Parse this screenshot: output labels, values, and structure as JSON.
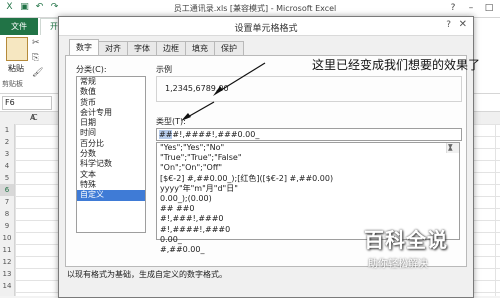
{
  "excel": {
    "window_title": "员工通讯录.xls [兼容模式] - Microsoft Excel",
    "file_tab": "文件",
    "home_tab": "开",
    "paste_label": "粘贴",
    "clipboard_group": "剪贴板",
    "name_box": "F6",
    "column_headers": [
      "A",
      "B",
      "C"
    ],
    "row_headers": [
      "1",
      "2",
      "3",
      "4",
      "5",
      "6",
      "7",
      "8",
      "9",
      "10",
      "11",
      "12",
      "13",
      "14"
    ],
    "selected_row": "6"
  },
  "dialog": {
    "title": "设置单元格格式",
    "help_icon": "?",
    "close_icon": "✕",
    "tabs": [
      "数字",
      "对齐",
      "字体",
      "边框",
      "填充",
      "保护"
    ],
    "category_label": "分类(C):",
    "categories": [
      "常规",
      "数值",
      "货币",
      "会计专用",
      "日期",
      "时间",
      "百分比",
      "分数",
      "科学记数",
      "文本",
      "特殊",
      "自定义"
    ],
    "selected_category": "自定义",
    "sample_label": "示例",
    "sample_value": "1,2345,6789.00",
    "type_label": "类型(T):",
    "type_input_highlight": "##",
    "type_input_rest": "#!,####!,###0.00_",
    "type_list": [
      "\"Yes\";\"Yes\";\"No\"",
      "\"True\";\"True\";\"False\"",
      "\"On\";\"On\";\"Off\"",
      "[$€-2] #,##0.00_);[红色]([$€-2] #,##0.00)",
      "yyyy\"年\"m\"月\"d\"日\"",
      "0.00_);(0.00)",
      "## ##0",
      "#!,###!,###0",
      "#!,####!,###0",
      "0.00_",
      "#,##0.00_"
    ],
    "description": "以现有格式为基础，生成自定义的数字格式。"
  },
  "annotation": {
    "text": "这里已经变成我们想要的效果了"
  },
  "watermark": {
    "big": "百科全说",
    "small": "助你轻松解决"
  },
  "colors": {
    "excel_green": "#217346",
    "selection_blue": "#3f7bd6"
  }
}
